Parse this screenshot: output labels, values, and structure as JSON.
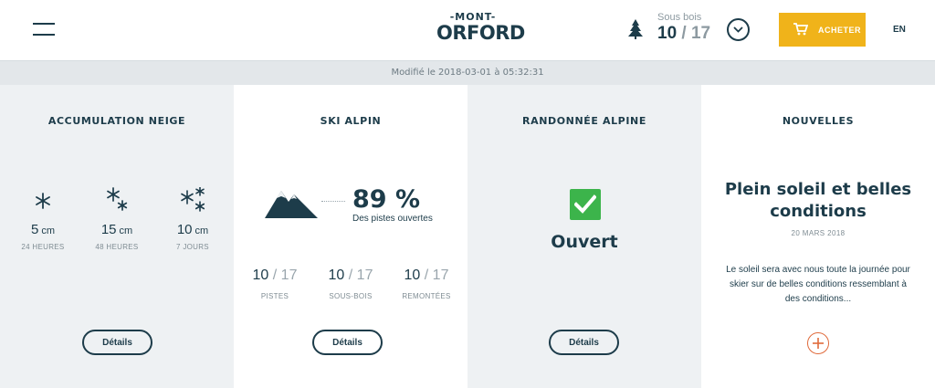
{
  "header": {
    "logo_top": "-MONT-",
    "logo_bottom": "ORFORD",
    "sous_bois_label": "Sous bois",
    "sous_bois_open": "10",
    "sous_bois_total": "17",
    "buy_label": "ACHETER",
    "language": "EN",
    "icons": {
      "menu": "hamburger-menu-icon",
      "tree": "tree-icon",
      "toggle": "chevron-down-icon",
      "cart": "cart-icon"
    },
    "accent_color": "#f0b31a"
  },
  "modified": "Modifié le 2018-03-01 à 05:32:31",
  "panels": {
    "snow": {
      "title": "ACCUMULATION NEIGE",
      "items": [
        {
          "value": "5",
          "unit": "cm",
          "period": "24 HEURES",
          "icon": "snowflake-icon"
        },
        {
          "value": "15",
          "unit": "cm",
          "period": "48 HEURES",
          "icon": "snowflakes-icon"
        },
        {
          "value": "10",
          "unit": "cm",
          "period": "7 JOURS",
          "icon": "snowflakes-many-icon"
        }
      ],
      "details_label": "Détails"
    },
    "ski": {
      "title": "SKI ALPIN",
      "percent": "89 %",
      "percent_label": "Des pistes ouvertes",
      "stats": [
        {
          "open": "10",
          "total": "17",
          "label": "PISTES"
        },
        {
          "open": "10",
          "total": "17",
          "label": "SOUS-BOIS"
        },
        {
          "open": "10",
          "total": "17",
          "label": "REMONTÉES"
        }
      ],
      "details_label": "Détails"
    },
    "rando": {
      "title": "RANDONNÉE ALPINE",
      "status": "Ouvert",
      "status_color": "#3cb44b",
      "details_label": "Détails"
    },
    "news": {
      "title": "NOUVELLES",
      "headline": "Plein soleil et belles conditions",
      "date": "20 MARS 2018",
      "body": "Le soleil sera avec nous toute la journée pour skier sur de belles conditions ressemblant à des conditions...",
      "more_icon": "plus-circle-icon",
      "more_color": "#e06a3b"
    }
  }
}
